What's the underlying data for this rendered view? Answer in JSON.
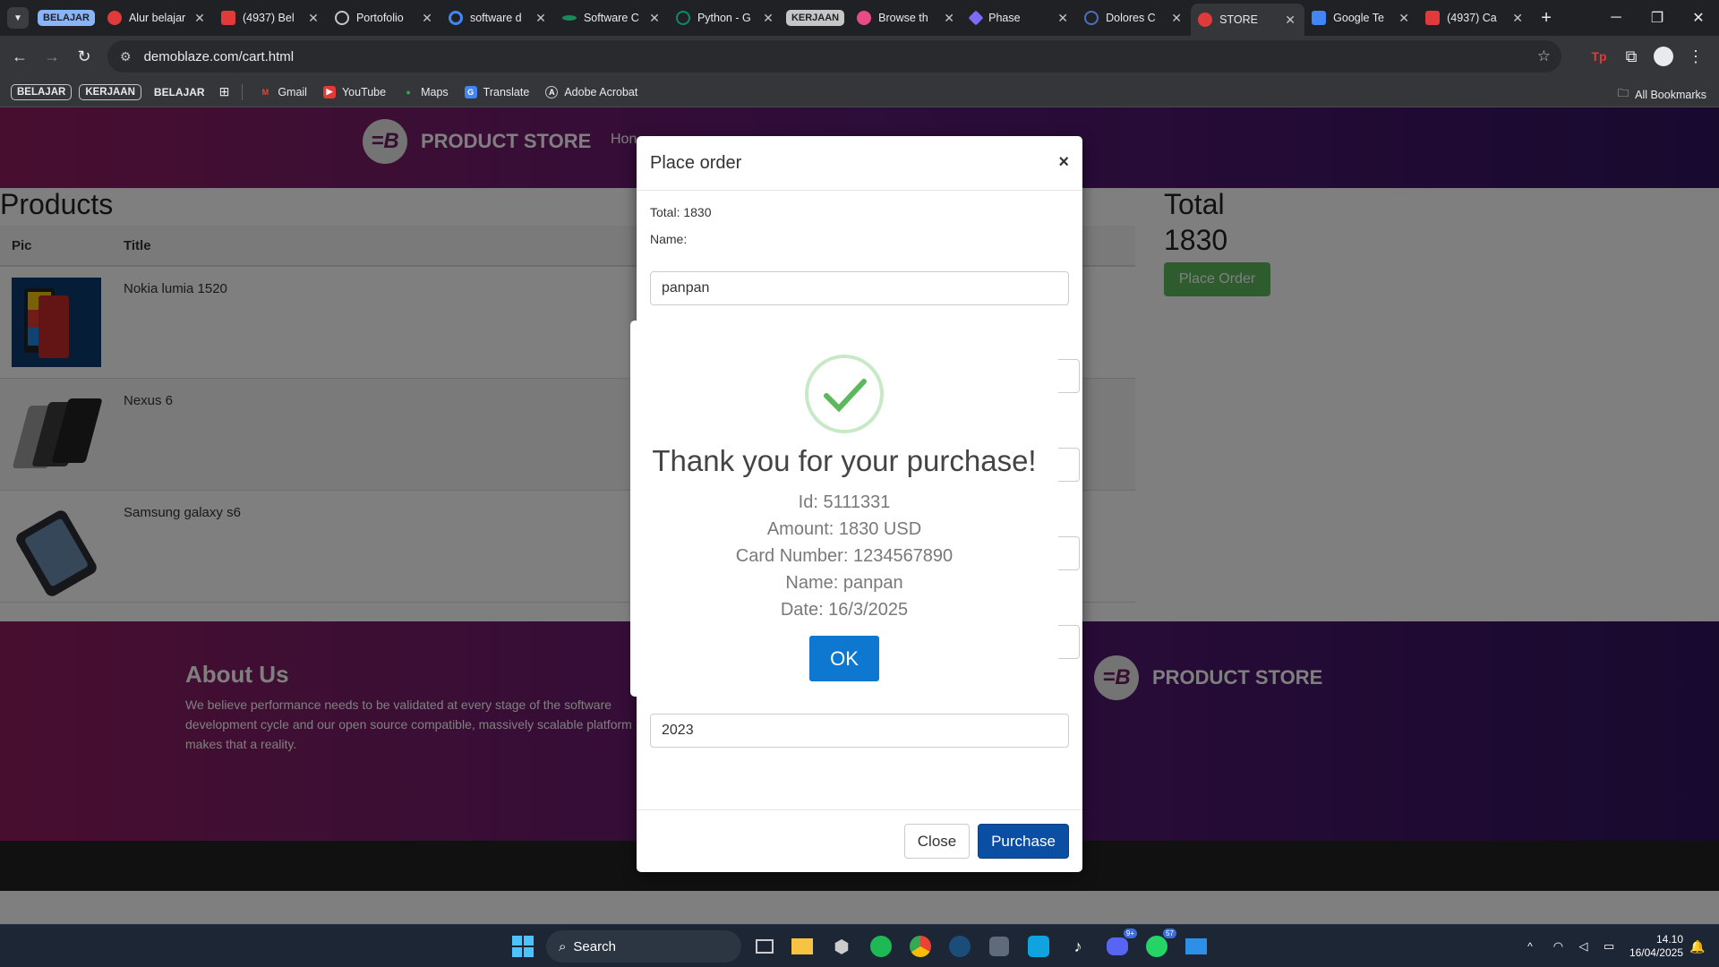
{
  "browser": {
    "tab_groups": [
      {
        "label": "BELAJAR",
        "color": "#8ab4f8"
      },
      {
        "label": "KERJAAN",
        "color": "#c4c7c5"
      }
    ],
    "tabs": [
      {
        "title": "Alur belajar",
        "icon": "youtube-icon",
        "color": "#e03a3a"
      },
      {
        "title": "(4937) Bel",
        "icon": "youtube-icon",
        "color": "#e03a3a"
      },
      {
        "title": "Portofolio",
        "icon": "globe-icon",
        "color": "#c4c7c5"
      },
      {
        "title": "software d",
        "icon": "google-icon",
        "color": "#4285f4"
      },
      {
        "title": "Software C",
        "icon": "site-icon",
        "color": "#1b8a5a"
      },
      {
        "title": "Python - G",
        "icon": "site-icon",
        "color": "#0d8a6b"
      },
      {
        "title": "Browse th",
        "icon": "dribbble-icon",
        "color": "#e84c88"
      },
      {
        "title": "Phase",
        "icon": "phase-icon",
        "color": "#7b6cf6"
      },
      {
        "title": "Dolores C",
        "icon": "site-icon",
        "color": "#4d6fbf"
      },
      {
        "title": "STORE",
        "icon": "store-icon",
        "color": "#e03a3a"
      },
      {
        "title": "Google Te",
        "icon": "translate-icon",
        "color": "#4285f4"
      },
      {
        "title": "(4937) Ca",
        "icon": "youtube-icon",
        "color": "#e03a3a"
      }
    ],
    "url": "demoblaze.com/cart.html",
    "bookmarks": {
      "chip1": "BELAJAR",
      "chip2": "KERJAAN",
      "text1": "BELAJAR",
      "items": [
        "Gmail",
        "YouTube",
        "Maps",
        "Translate",
        "Adobe Acrobat"
      ],
      "all": "All Bookmarks"
    }
  },
  "store": {
    "brand": "PRODUCT STORE",
    "nav_visible": "Hon",
    "products_title": "Products",
    "columns": [
      "Pic",
      "Title"
    ],
    "rows": [
      {
        "title": "Nokia lumia 1520"
      },
      {
        "title": "Nexus 6"
      },
      {
        "title": "Samsung galaxy s6"
      }
    ],
    "total_label": "Total",
    "total_value": "1830",
    "place_order": "Place Order",
    "about_title": "About Us",
    "about_text": "We believe performance needs to be validated at every stage of the software development cycle and our open source compatible, massively scalable platform makes that a reality."
  },
  "order_modal": {
    "title": "Place order",
    "close_x": "×",
    "total": "Total: 1830",
    "name_label": "Name:",
    "name_value": "panpan",
    "year_value": "2023",
    "close": "Close",
    "purchase": "Purchase"
  },
  "alert": {
    "title": "Thank you for your purchase!",
    "id": "Id: 5111331",
    "amount": "Amount: 1830 USD",
    "card": "Card Number: 1234567890",
    "name": "Name: panpan",
    "date": "Date: 16/3/2025",
    "ok": "OK"
  },
  "taskbar": {
    "search": "Search",
    "time": "14.10",
    "date": "16/04/2025",
    "badges": {
      "discord": "9+",
      "whatsapp": "57"
    }
  }
}
